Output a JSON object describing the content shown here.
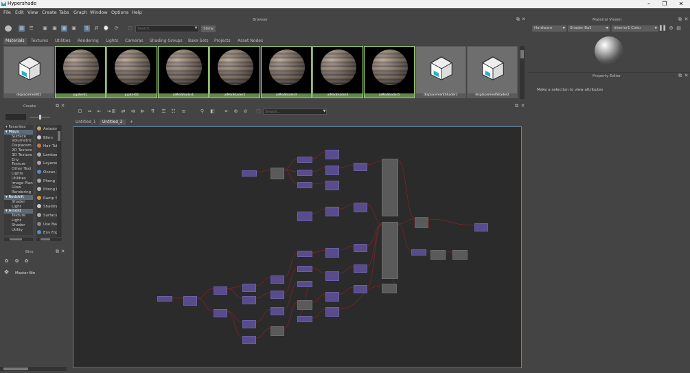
{
  "window": {
    "title": "Hypershade"
  },
  "menus": [
    "File",
    "Edit",
    "View",
    "Create",
    "Tabs",
    "Graph",
    "Window",
    "Options",
    "Help"
  ],
  "browser": {
    "title": "Browser",
    "search_placeholder": "Search...",
    "show_label": "Show",
    "tabs": [
      "Materials",
      "Textures",
      "Utilities",
      "Rendering",
      "Lights",
      "Cameras",
      "Shading Groups",
      "Bake Sets",
      "Projects",
      "Asset Nodes"
    ],
    "thumbs": [
      {
        "type": "cube",
        "label": "displacement01"
      },
      {
        "type": "planet",
        "label": "jupiter01"
      },
      {
        "type": "planet",
        "label": "jupiter02"
      },
      {
        "type": "planet",
        "label": "aiMixShader1"
      },
      {
        "type": "planet",
        "label": "aiMixShader2"
      },
      {
        "type": "planet",
        "label": "aiMixShader3"
      },
      {
        "type": "planet",
        "label": "aiMixShader4"
      },
      {
        "type": "planet",
        "label": "aiMixShader5"
      },
      {
        "type": "cube",
        "label": "displacementShader1"
      },
      {
        "type": "cube",
        "label": "displacementShader2"
      }
    ]
  },
  "create": {
    "title": "Create",
    "tree": [
      "Favorites",
      "Maya",
      "Surface",
      "Volumetric",
      "Displacem",
      "2D Texture",
      "3D Texture",
      "Env Texture",
      "Other Text",
      "Lights",
      "Utilities",
      "Image Plan",
      "Glow",
      "Rendering",
      "Redshift",
      "Shader",
      "Light",
      "Arnold",
      "Texture",
      "Light",
      "Shader",
      "Utility"
    ],
    "materials": [
      "Anisotro",
      "Blinn",
      "Hair Tub",
      "Lambert",
      "Layered",
      "Ocean S",
      "Phong",
      "Phong E",
      "Ramp S",
      "Shading",
      "Surface",
      "Use Bac",
      "Env Fog"
    ]
  },
  "bins": {
    "title": "Bins",
    "master": "Master Bin"
  },
  "graph": {
    "search_placeholder": "Search...",
    "tabs": [
      "Untitled_1",
      "Untitled_2"
    ]
  },
  "material_viewer": {
    "title": "Material Viewer",
    "renderer": "Hardware",
    "shape": "Shader Ball",
    "env": "Interior1 Color"
  },
  "property_editor": {
    "title": "Property Editor",
    "message": "Make a selection to view attributes"
  },
  "colors": {
    "accent": "#9fd47a",
    "selected_tab": "#5c6b7a",
    "node": "#584c8c",
    "wire": "#8a2222"
  }
}
